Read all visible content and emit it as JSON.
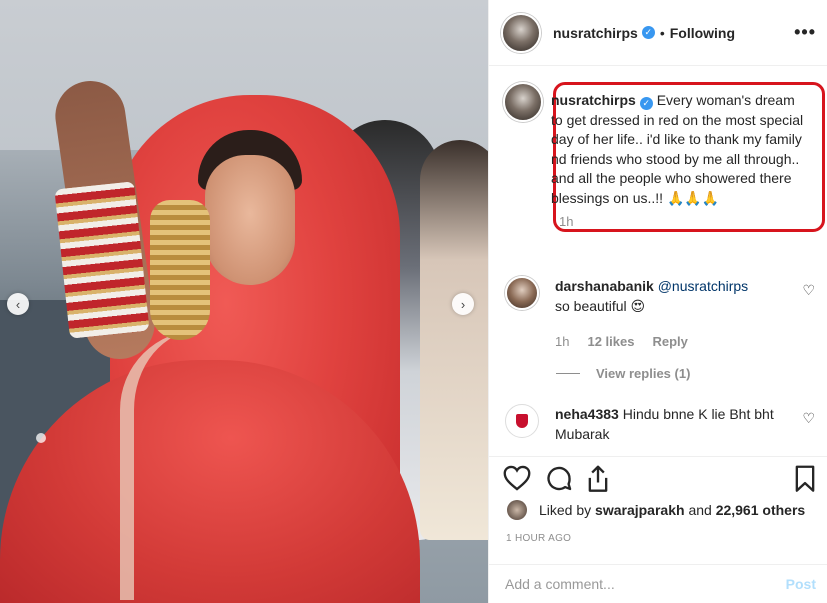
{
  "post": {
    "username": "nusratchirps",
    "follow_status": "Following",
    "separator": "•",
    "more_label": "•••",
    "caption": "Every woman's dream to get dressed in red on the most special day of her life.. i'd like to thank my family nd friends who stood by me all through.. and all the people who showered there blessings on us..!! 🙏🙏🙏",
    "caption_time": "1h"
  },
  "comments": [
    {
      "username": "darshanabanik",
      "mention": "@nusratchirps",
      "text": "so beautiful 😍",
      "time": "1h",
      "likes": "12 likes",
      "reply_label": "Reply",
      "view_replies": "View replies (1)"
    },
    {
      "username": "neha4383",
      "text": "Hindu bnne K lie Bht bht Mubarak"
    }
  ],
  "likes": {
    "prefix": "Liked by",
    "liker": "swarajparakh",
    "and": "and",
    "others": "22,961 others"
  },
  "timestamp": "1 HOUR AGO",
  "add_comment": {
    "placeholder": "Add a comment...",
    "post_label": "Post"
  },
  "carousel": {
    "prev": "‹",
    "next": "›"
  },
  "colors": {
    "highlight_border": "#d7141d",
    "verified": "#3897f0",
    "post_button": "#b2dffc"
  }
}
